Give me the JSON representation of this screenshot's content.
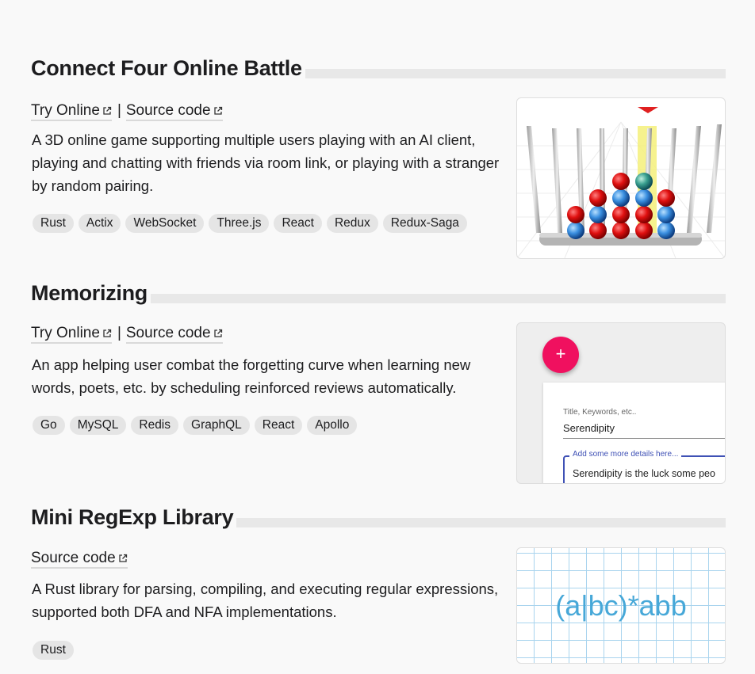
{
  "projects": [
    {
      "title": "Connect Four Online Battle",
      "try_online": "Try Online",
      "source_code": "Source code",
      "separator": "|",
      "description": "A 3D online game supporting multiple users playing with an AI client, playing and chatting with friends via room link, or playing with a stranger by random pairing.",
      "tags": [
        "Rust",
        "Actix",
        "WebSocket",
        "Three.js",
        "React",
        "Redux",
        "Redux-Saga"
      ]
    },
    {
      "title": "Memorizing",
      "try_online": "Try Online",
      "source_code": "Source code",
      "separator": "|",
      "description": "An app helping user combat the forgetting curve when learning new words, poets, etc. by scheduling reinforced reviews automatically.",
      "tags": [
        "Go",
        "MySQL",
        "Redis",
        "GraphQL",
        "React",
        "Apollo"
      ],
      "preview": {
        "fab_label": "+",
        "field_label": "Title, Keywords, etc..",
        "field_value": "Serendipity",
        "details_label": "Add some more details here...",
        "details_value": "Serendipity is the luck some peo"
      }
    },
    {
      "title": "Mini RegExp Library",
      "source_code": "Source code",
      "description": "A Rust library for parsing, compiling, and executing regular expressions, supported both DFA and NFA implementations.",
      "tags": [
        "Rust"
      ],
      "preview": {
        "regex_text": "(a|bc)*abb"
      }
    }
  ],
  "colors": {
    "accent_pink": "#f0105f",
    "regex_blue": "#47a8d8",
    "grid_blue": "#a9d4ee",
    "material_blue": "#3f51b5"
  }
}
